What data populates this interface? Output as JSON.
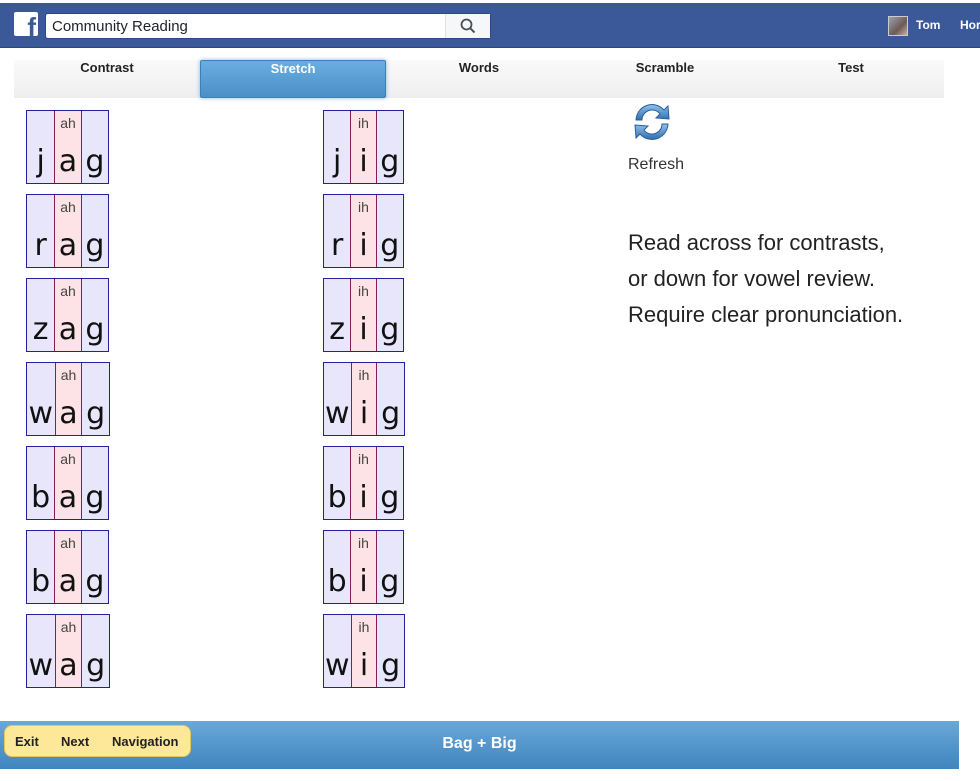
{
  "topbar": {
    "search_value": "Community Reading",
    "user_name": "Tom",
    "home_label": "Hor"
  },
  "tabs": [
    {
      "label": "Contrast",
      "active": false
    },
    {
      "label": "Stretch",
      "active": true
    },
    {
      "label": "Words",
      "active": false
    },
    {
      "label": "Scramble",
      "active": false
    },
    {
      "label": "Test",
      "active": false
    }
  ],
  "words_left": [
    {
      "onset": "j",
      "vowel": "a",
      "coda": "g",
      "sound": "ah"
    },
    {
      "onset": "r",
      "vowel": "a",
      "coda": "g",
      "sound": "ah"
    },
    {
      "onset": "z",
      "vowel": "a",
      "coda": "g",
      "sound": "ah"
    },
    {
      "onset": "w",
      "vowel": "a",
      "coda": "g",
      "sound": "ah"
    },
    {
      "onset": "b",
      "vowel": "a",
      "coda": "g",
      "sound": "ah"
    },
    {
      "onset": "b",
      "vowel": "a",
      "coda": "g",
      "sound": "ah"
    },
    {
      "onset": "w",
      "vowel": "a",
      "coda": "g",
      "sound": "ah"
    }
  ],
  "words_right": [
    {
      "onset": "j",
      "vowel": "i",
      "coda": "g",
      "sound": "ih"
    },
    {
      "onset": "r",
      "vowel": "i",
      "coda": "g",
      "sound": "ih"
    },
    {
      "onset": "z",
      "vowel": "i",
      "coda": "g",
      "sound": "ih"
    },
    {
      "onset": "w",
      "vowel": "i",
      "coda": "g",
      "sound": "ih"
    },
    {
      "onset": "b",
      "vowel": "i",
      "coda": "g",
      "sound": "ih"
    },
    {
      "onset": "b",
      "vowel": "i",
      "coda": "g",
      "sound": "ih"
    },
    {
      "onset": "w",
      "vowel": "i",
      "coda": "g",
      "sound": "ih"
    }
  ],
  "refresh": {
    "label": "Refresh",
    "icon": "refresh-icon"
  },
  "instructions": [
    "Read across for contrasts,",
    "or down for vowel review.",
    "Require clear pronunciation."
  ],
  "bottom": {
    "exit_label": "Exit",
    "next_label": "Next",
    "nav_label": "Navigation",
    "title": "Bag + Big"
  },
  "colors": {
    "fb_blue": "#3b5998",
    "tab_active": "#4a8fc6",
    "consonant_bg": "#e8e6fb",
    "vowel_bg": "#fde3e6",
    "bottom_buttons": "#fde89a"
  }
}
